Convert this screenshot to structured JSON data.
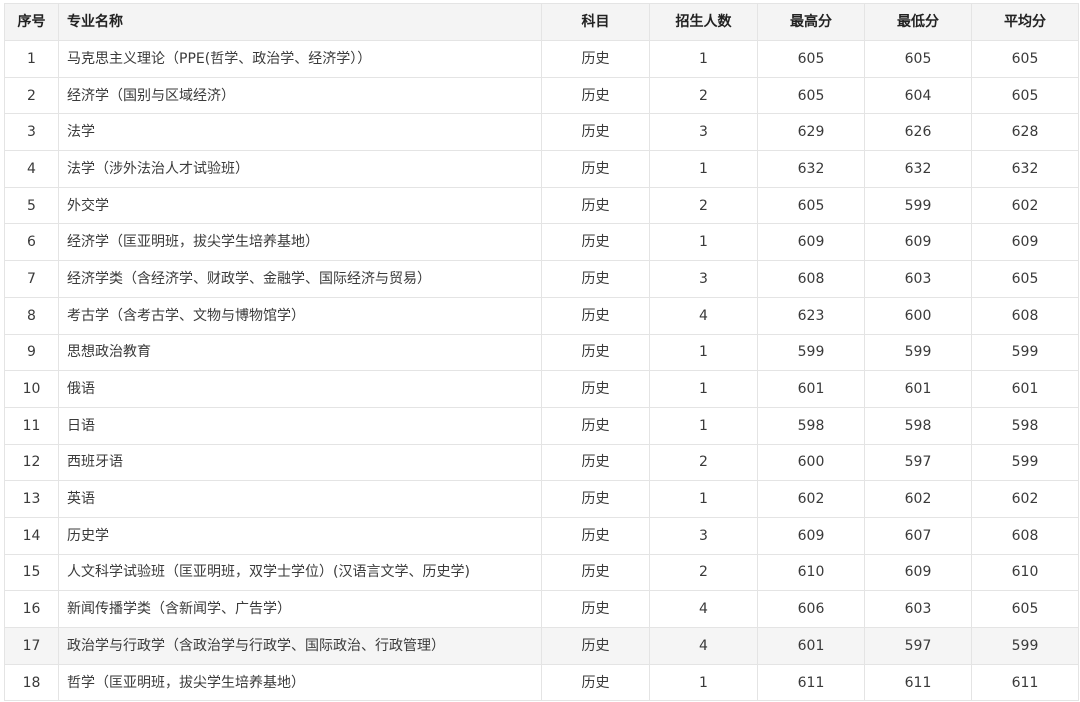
{
  "table": {
    "headers": {
      "idx": "序号",
      "name": "专业名称",
      "subject": "科目",
      "enroll": "招生人数",
      "max": "最高分",
      "min": "最低分",
      "avg": "平均分"
    },
    "rows": [
      {
        "idx": "1",
        "name": "马克思主义理论（PPE(哲学、政治学、经济学））",
        "subject": "历史",
        "enroll": "1",
        "max": "605",
        "min": "605",
        "avg": "605"
      },
      {
        "idx": "2",
        "name": "经济学（国别与区域经济）",
        "subject": "历史",
        "enroll": "2",
        "max": "605",
        "min": "604",
        "avg": "605"
      },
      {
        "idx": "3",
        "name": "法学",
        "subject": "历史",
        "enroll": "3",
        "max": "629",
        "min": "626",
        "avg": "628"
      },
      {
        "idx": "4",
        "name": "法学（涉外法治人才试验班）",
        "subject": "历史",
        "enroll": "1",
        "max": "632",
        "min": "632",
        "avg": "632"
      },
      {
        "idx": "5",
        "name": "外交学",
        "subject": "历史",
        "enroll": "2",
        "max": "605",
        "min": "599",
        "avg": "602"
      },
      {
        "idx": "6",
        "name": "经济学（匡亚明班，拔尖学生培养基地）",
        "subject": "历史",
        "enroll": "1",
        "max": "609",
        "min": "609",
        "avg": "609"
      },
      {
        "idx": "7",
        "name": "经济学类（含经济学、财政学、金融学、国际经济与贸易）",
        "subject": "历史",
        "enroll": "3",
        "max": "608",
        "min": "603",
        "avg": "605"
      },
      {
        "idx": "8",
        "name": "考古学（含考古学、文物与博物馆学）",
        "subject": "历史",
        "enroll": "4",
        "max": "623",
        "min": "600",
        "avg": "608"
      },
      {
        "idx": "9",
        "name": "思想政治教育",
        "subject": "历史",
        "enroll": "1",
        "max": "599",
        "min": "599",
        "avg": "599"
      },
      {
        "idx": "10",
        "name": "俄语",
        "subject": "历史",
        "enroll": "1",
        "max": "601",
        "min": "601",
        "avg": "601"
      },
      {
        "idx": "11",
        "name": "日语",
        "subject": "历史",
        "enroll": "1",
        "max": "598",
        "min": "598",
        "avg": "598"
      },
      {
        "idx": "12",
        "name": "西班牙语",
        "subject": "历史",
        "enroll": "2",
        "max": "600",
        "min": "597",
        "avg": "599"
      },
      {
        "idx": "13",
        "name": "英语",
        "subject": "历史",
        "enroll": "1",
        "max": "602",
        "min": "602",
        "avg": "602"
      },
      {
        "idx": "14",
        "name": "历史学",
        "subject": "历史",
        "enroll": "3",
        "max": "609",
        "min": "607",
        "avg": "608"
      },
      {
        "idx": "15",
        "name": "人文科学试验班（匡亚明班，双学士学位）(汉语言文学、历史学)",
        "subject": "历史",
        "enroll": "2",
        "max": "610",
        "min": "609",
        "avg": "610"
      },
      {
        "idx": "16",
        "name": "新闻传播学类（含新闻学、广告学）",
        "subject": "历史",
        "enroll": "4",
        "max": "606",
        "min": "603",
        "avg": "605"
      },
      {
        "idx": "17",
        "name": "政治学与行政学（含政治学与行政学、国际政治、行政管理）",
        "subject": "历史",
        "enroll": "4",
        "max": "601",
        "min": "597",
        "avg": "599"
      },
      {
        "idx": "18",
        "name": "哲学（匡亚明班，拔尖学生培养基地）",
        "subject": "历史",
        "enroll": "1",
        "max": "611",
        "min": "611",
        "avg": "611"
      }
    ]
  }
}
